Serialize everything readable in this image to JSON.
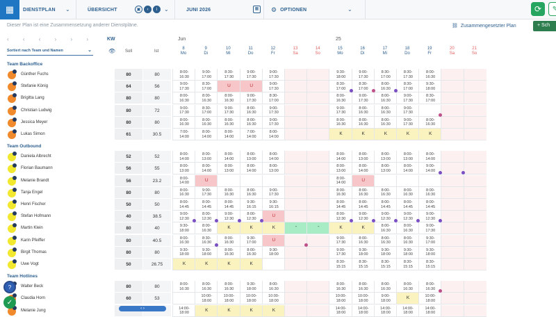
{
  "toolbar": {
    "module": "DIENSTPLAN",
    "view": "ÜBERSICHT",
    "month": "JUNI 2026",
    "options": "OPTIONEN"
  },
  "info_text": "Dieser Plan ist eine Zusammensetzung anderer Dienstpläne.",
  "composite_link": "Zusammengesetzter Plan",
  "add_label": "+ Sch",
  "sort_label": "Sortiert nach Team und Namen",
  "headers": {
    "kw": "KW",
    "month": "Jun",
    "week_no": "25",
    "soll": "Soll",
    "ist": "Ist"
  },
  "days": [
    {
      "d": "8",
      "w": "Mo",
      "we": false
    },
    {
      "d": "9",
      "w": "Di",
      "we": false
    },
    {
      "d": "10",
      "w": "Mi",
      "we": false
    },
    {
      "d": "11",
      "w": "Do",
      "we": false
    },
    {
      "d": "12",
      "w": "Fr",
      "we": false
    },
    {
      "d": "13",
      "w": "Sa",
      "we": true
    },
    {
      "d": "14",
      "w": "So",
      "we": true
    },
    {
      "d": "15",
      "w": "Mo",
      "we": false
    },
    {
      "d": "16",
      "w": "Di",
      "we": false
    },
    {
      "d": "17",
      "w": "Mi",
      "we": false
    },
    {
      "d": "18",
      "w": "Do",
      "we": false
    },
    {
      "d": "19",
      "w": "Fr",
      "we": false
    },
    {
      "d": "20",
      "w": "Sa",
      "we": true
    },
    {
      "d": "21",
      "w": "So",
      "we": true
    }
  ],
  "groups": [
    {
      "name": "Team Backoffice",
      "people": [
        {
          "name": "Günther Fuchs",
          "soll": "80",
          "ist": "80",
          "color": "#f08a2c",
          "cells": [
            "8:00-16:30",
            "9:00-17:00",
            "8:30-17:30",
            "9:00-17:30",
            "9:00-17:30",
            "",
            "",
            "9:30-18:00",
            "9:00-17:30",
            "8:30-17:00",
            "8:30-17:30",
            "8:00-16:30",
            "",
            ""
          ]
        },
        {
          "name": "Stefanie König",
          "soll": "64",
          "ist": "56",
          "color": "#f08a2c",
          "cells": [
            "9:00-17:30",
            "8:30-17:00",
            "U",
            "U",
            "9:00-17:30",
            "",
            "",
            "8:30-17:00",
            "8:30-17:00",
            "8:00-16:30",
            "8:30-17:00",
            "9:30-18:00",
            "",
            ""
          ]
        },
        {
          "name": "Brigitta Lang",
          "soll": "80",
          "ist": "80",
          "color": "#f08a2c",
          "cells": [
            "8:00-16:30",
            "8:00-16:30",
            "8:00-16:30",
            "9:00-17:30",
            "8:30-17:00",
            "",
            "",
            "8:00-16:30",
            "9:00-17:30",
            "8:00-16:30",
            "9:00-17:30",
            "8:30-17:00",
            "",
            ""
          ]
        },
        {
          "name": "Christian Ludwig",
          "soll": "80",
          "ist": "72",
          "color": "#f08a2c",
          "cells": [
            "9:00-17:30",
            "8:30-17:00",
            "9:00-17:30",
            "8:00-16:30",
            "9:00-17:30",
            "",
            "",
            "9:00-17:30",
            "8:00-16:30",
            "8:00-16:30",
            "9:00-17:30",
            "",
            "",
            ""
          ]
        },
        {
          "name": "Jessica Meyer",
          "soll": "80",
          "ist": "80",
          "color": "#f08a2c",
          "cells": [
            "8:00-16:30",
            "8:00-16:30",
            "8:00-16:30",
            "8:00-16:30",
            "9:00-17:30",
            "",
            "",
            "8:00-16:30",
            "8:00-16:30",
            "8:00-16:30",
            "9:00-17:30",
            "8:00-16:30",
            "",
            ""
          ]
        },
        {
          "name": "Lukas Simon",
          "soll": "61",
          "ist": "30.5",
          "color": "#f08a2c",
          "cells": [
            "7:00-14:00",
            "8:00-14:00",
            "8:00-14:00",
            "7:00-14:00",
            "8:00-14:00",
            "",
            "",
            "K",
            "K",
            "K",
            "K",
            "K",
            "",
            ""
          ]
        }
      ]
    },
    {
      "name": "Team Outbound",
      "people": [
        {
          "name": "Daniela Albrecht",
          "soll": "52",
          "ist": "52",
          "color": "#f3e830",
          "cells": [
            "8:00-14:00",
            "8:00-13:00",
            "8:00-14:00",
            "8:00-13:00",
            "8:00-14:00",
            "",
            "",
            "8:00-14:00",
            "8:00-13:00",
            "8:00-13:00",
            "8:00-13:00",
            "8:00-14:00",
            "",
            ""
          ]
        },
        {
          "name": "Florian Baumann",
          "soll": "56",
          "ist": "55",
          "color": "#f3e830",
          "cells": [
            "8:00-13:00",
            "8:00-14:00",
            "8:00-13:00",
            "8:00-14:00",
            "8:00-13:00",
            "",
            "",
            "8:00-13:00",
            "8:00-14:00",
            "8:00-13:00",
            "8:00-14:00",
            "9:00-14:00",
            "",
            ""
          ]
        },
        {
          "name": "Melanie Brandt",
          "soll": "56",
          "ist": "23.2",
          "color": "#f3e830",
          "cells": [
            "8:00-14:00",
            "U",
            "",
            "",
            "",
            "",
            "",
            "8:00-14:00",
            "U",
            "",
            "",
            "",
            "",
            ""
          ]
        },
        {
          "name": "Tanja Engel",
          "soll": "80",
          "ist": "80",
          "color": "#f3e830",
          "cells": [
            "8:00-16:30",
            "9:00-17:30",
            "8:00-16:30",
            "8:00-16:30",
            "9:00-17:30",
            "",
            "",
            "8:00-16:30",
            "8:00-16:30",
            "8:00-16:30",
            "8:00-16:30",
            "8:00-16:30",
            "",
            ""
          ]
        },
        {
          "name": "Henri Fischer",
          "soll": "50",
          "ist": "50",
          "color": "#f3e830",
          "cells": [
            "8:00-14:45",
            "8:00-14:45",
            "8:00-14:45",
            "9:30-16:15",
            "9:30-16:15",
            "",
            "",
            "8:00-14:45",
            "8:00-14:45",
            "8:00-14:45",
            "8:00-14:45",
            "8:00-14:45",
            "",
            ""
          ]
        },
        {
          "name": "Stefan Hofmann",
          "soll": "40",
          "ist": "38.5",
          "color": "#f3e830",
          "cells": [
            "9:00-12:30",
            "8:00-12:30",
            "9:00-12:30",
            "8:00-12:30",
            "U",
            "",
            "",
            "8:00-12:30",
            "9:00-12:30",
            "9:00-12:30",
            "9:00-12:30",
            "9:00-12:30",
            "",
            ""
          ]
        },
        {
          "name": "Martin Klein",
          "soll": "80",
          "ist": "40",
          "color": "#f3e830",
          "cells": [
            "9:30-18:00",
            "8:00-16:30",
            "K",
            "K",
            "K",
            "-",
            "-",
            "K",
            "K",
            "8:00-16:30",
            "8:00-16:30",
            "9:00-17:30",
            "",
            ""
          ]
        },
        {
          "name": "Karin Pfeiffer",
          "soll": "80",
          "ist": "40.5",
          "color": "#f3e830",
          "cells": [
            "8:00-16:30",
            "8:30-16:30",
            "8:00-16:30",
            "9:30-17:00",
            "U",
            "",
            "",
            "9:00-17:30",
            "8:00-16:30",
            "8:00-16:30",
            "8:00-16:30",
            "9:30-17:00",
            "",
            ""
          ]
        },
        {
          "name": "Birgit Thomas",
          "soll": "80",
          "ist": "80",
          "color": "#f3e830",
          "cells": [
            "9:30-18:00",
            "9:30-18:00",
            "8:00-16:30",
            "8:00-16:30",
            "9:30-18:00",
            "",
            "",
            "9:00-17:30",
            "9:30-18:00",
            "9:30-18:00",
            "9:30-18:00",
            "9:30-18:00",
            "",
            ""
          ]
        },
        {
          "name": "Uwe Vogt",
          "soll": "50",
          "ist": "26.75",
          "color": "#f3e830",
          "cells": [
            "K",
            "K",
            "K",
            "K",
            "",
            "",
            "",
            "8:30-15:15",
            "8:30-15:15",
            "8:30-15:15",
            "8:30-15:15",
            "8:30-15:15",
            "",
            ""
          ]
        }
      ]
    },
    {
      "name": "Team Hotlines",
      "people": [
        {
          "name": "Walter Beck",
          "soll": "80",
          "ist": "80",
          "color": "#f08a2c",
          "cells": [
            "8:00-16:30",
            "8:00-16:30",
            "8:00-16:30",
            "9:30-18:00",
            "8:00-16:30",
            "",
            "",
            "8:00-16:30",
            "8:00-16:30",
            "8:00-16:30",
            "8:00-16:30",
            "8:00-16:30",
            "",
            ""
          ]
        },
        {
          "name": "Claudia Horn",
          "soll": "60",
          "ist": "53",
          "color": "#f08a2c",
          "cells": [
            "",
            "10:00-18:00",
            "10:00-18:00",
            "10:00-18:00",
            "10:00-18:00",
            "",
            "",
            "10:00-18:00",
            "10:00-18:00",
            "9:00-18:00",
            "K",
            "10:00-18:00",
            "",
            ""
          ]
        },
        {
          "name": "Melanie Jung",
          "soll": "",
          "ist": "",
          "color": "#f08a2c",
          "cells": [
            "14:00-18:00",
            "K",
            "K",
            "K",
            "K",
            "",
            "",
            "14:00-18:00",
            "14:00-18:00",
            "14:00-18:00",
            "14:00-18:00",
            "14:00-18:00",
            "",
            ""
          ]
        }
      ]
    }
  ],
  "dots": [
    {
      "r": 1,
      "c": 7,
      "type": "purple"
    },
    {
      "r": 1,
      "c": 8,
      "type": "pink"
    },
    {
      "r": 1,
      "c": 9,
      "type": "purple"
    },
    {
      "r": 3,
      "c": 11,
      "type": "pink"
    },
    {
      "r": 7,
      "c": 11,
      "type": "purple"
    },
    {
      "r": 7,
      "c": 12,
      "type": "purple"
    },
    {
      "r": 11,
      "c": 0,
      "type": "purple"
    },
    {
      "r": 11,
      "c": 1,
      "type": "purple"
    },
    {
      "r": 11,
      "c": 2,
      "type": "purple"
    },
    {
      "r": 11,
      "c": 3,
      "type": "purple"
    },
    {
      "r": 11,
      "c": 7,
      "type": "purple"
    },
    {
      "r": 11,
      "c": 8,
      "type": "purple"
    },
    {
      "r": 11,
      "c": 9,
      "type": "purple"
    },
    {
      "r": 11,
      "c": 10,
      "type": "purple"
    },
    {
      "r": 11,
      "c": 11,
      "type": "purple"
    },
    {
      "r": 13,
      "c": 1,
      "type": "purple"
    },
    {
      "r": 13,
      "c": 5,
      "type": "pink"
    },
    {
      "r": 16,
      "c": 11,
      "type": "pink"
    }
  ],
  "scroll_label": "‹ ›"
}
